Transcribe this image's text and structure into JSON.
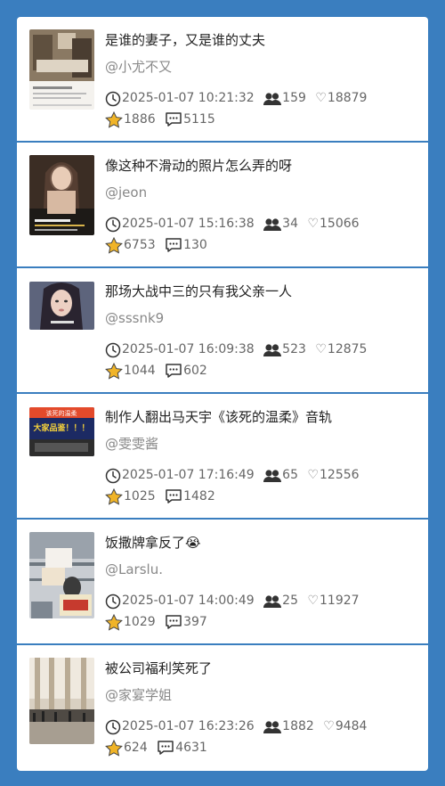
{
  "posts": [
    {
      "title": "是谁的妻子，又是谁的丈夫",
      "author": "@小尤不又",
      "time": "2025-01-07 10:21:32",
      "viewers": "159",
      "likes": "18879",
      "stars": "1886",
      "comments": "5115",
      "thumb_colors": [
        "#7b6a55",
        "#c9b79e",
        "#e9e4dc"
      ]
    },
    {
      "title": "像这种不滑动的照片怎么弄的呀",
      "author": "@jeon",
      "time": "2025-01-07 15:16:38",
      "viewers": "34",
      "likes": "15066",
      "stars": "6753",
      "comments": "130",
      "thumb_colors": [
        "#1d1a17",
        "#d7b9a2",
        "#5a4235"
      ]
    },
    {
      "title": "那场大战中三的只有我父亲一人",
      "author": "@sssnk9",
      "time": "2025-01-07 16:09:38",
      "viewers": "523",
      "likes": "12875",
      "stars": "1044",
      "comments": "602",
      "thumb_colors": [
        "#3b4254",
        "#e6c8bb",
        "#6f7891"
      ]
    },
    {
      "title": "制作人翻出马天宇《该死的温柔》音轨",
      "author": "@雯雯酱",
      "time": "2025-01-07 17:16:49",
      "viewers": "65",
      "likes": "12556",
      "stars": "1025",
      "comments": "1482",
      "thumb_colors": [
        "#1c2a63",
        "#e34a2b",
        "#f6d23b"
      ],
      "thumb_text_1": "该死的温柔",
      "thumb_text_2": "大家品鉴！！！"
    },
    {
      "title": "饭撒牌拿反了😭",
      "author": "@Larslu.",
      "time": "2025-01-07 14:00:49",
      "viewers": "25",
      "likes": "11927",
      "stars": "1029",
      "comments": "397",
      "thumb_colors": [
        "#c9cdd2",
        "#7e8791",
        "#efe3cf"
      ]
    },
    {
      "title": "被公司福利笑死了",
      "author": "@家宴学姐",
      "time": "2025-01-07 16:23:26",
      "viewers": "1882",
      "likes": "9484",
      "stars": "624",
      "comments": "4631",
      "thumb_colors": [
        "#b9ab95",
        "#efe9df",
        "#4f4a44"
      ]
    }
  ],
  "icons": {
    "time": "clock-icon",
    "viewers": "people-icon",
    "likes": "heart-icon",
    "stars": "star-icon",
    "comments": "comment-icon"
  },
  "colors": {
    "background": "#3a7ebf",
    "card": "#ffffff",
    "star": "#f0b428"
  }
}
